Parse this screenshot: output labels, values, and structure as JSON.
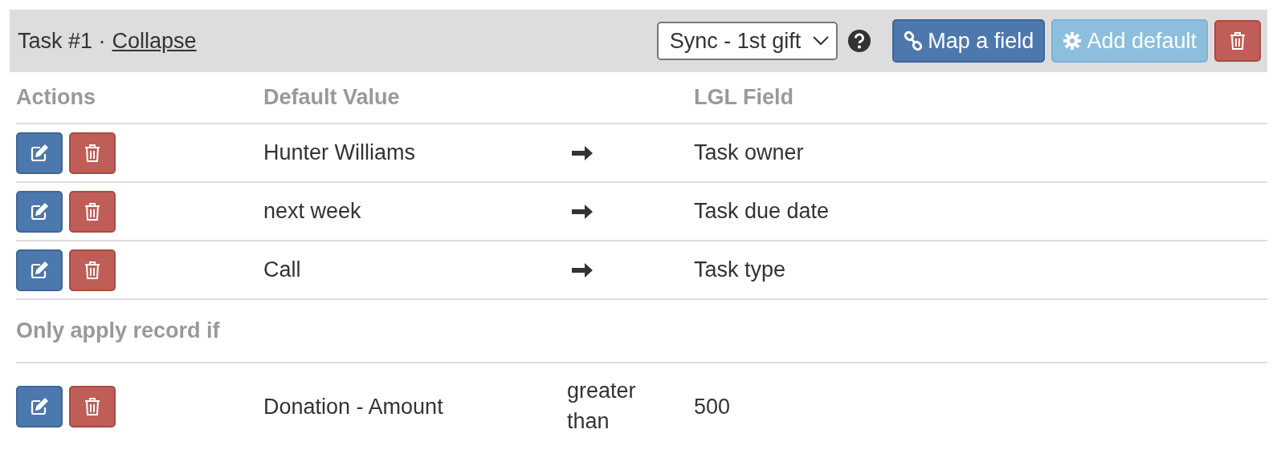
{
  "task": {
    "title": "Task #1 ·",
    "collapse_link": "Collapse",
    "select": {
      "value": "Sync - 1st gift"
    },
    "buttons": [
      {
        "kind": "primary",
        "label": "Map a field"
      },
      {
        "kind": "info",
        "label": "Add default"
      },
      {
        "kind": "danger"
      }
    ]
  },
  "columns": [
    "Actions",
    "Default Value",
    "LGL Field"
  ],
  "mappings": [
    {
      "value": "Hunter Williams",
      "field": "Task owner"
    },
    {
      "value": "next week",
      "field": "Task due date"
    },
    {
      "value": "Call",
      "field": "Task type"
    }
  ],
  "conditions_heading": "Only apply record if",
  "conditions": [
    {
      "field": "Donation - Amount",
      "operator": "greater than",
      "value": "500"
    }
  ]
}
